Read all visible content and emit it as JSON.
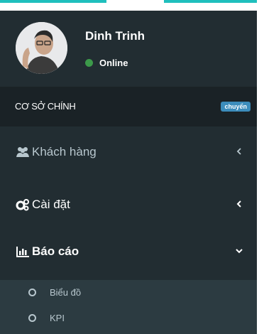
{
  "user": {
    "name": "Dinh Trinh",
    "status": "Online"
  },
  "branch": {
    "label": "CƠ SỞ CHÍNH",
    "badge": "chuyển"
  },
  "menu": [
    {
      "label": "Khách hàng",
      "icon": "users-icon",
      "chevron": "chevron-left-icon"
    },
    {
      "label": "Cài đặt",
      "icon": "gears-icon",
      "chevron": "chevron-left-icon"
    },
    {
      "label": "Báo cáo",
      "icon": "bar-chart-icon",
      "chevron": "chevron-down-icon"
    }
  ],
  "submenu": [
    {
      "label": "Biểu đồ",
      "icon": "circle-icon"
    },
    {
      "label": "KPI",
      "icon": "circle-icon"
    }
  ],
  "colors": {
    "accent": "#1fbfbd",
    "sidebar": "#222d32",
    "online": "#3c9a4a",
    "badge": "#3c8dbc"
  }
}
